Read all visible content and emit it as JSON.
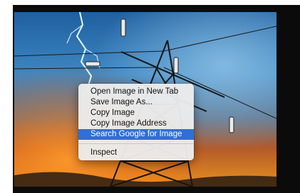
{
  "image": {
    "subject": "transmission-tower-lightning-photo"
  },
  "context_menu": {
    "items": [
      {
        "label": "Open Image in New Tab",
        "active": false
      },
      {
        "label": "Save Image As...",
        "active": false
      },
      {
        "label": "Copy Image",
        "active": false
      },
      {
        "label": "Copy Image Address",
        "active": false
      },
      {
        "label": "Search Google for Image",
        "active": true
      }
    ],
    "separator_after": 4,
    "footer_items": [
      {
        "label": "Inspect"
      }
    ],
    "highlight_color": "#2f6fd6"
  }
}
